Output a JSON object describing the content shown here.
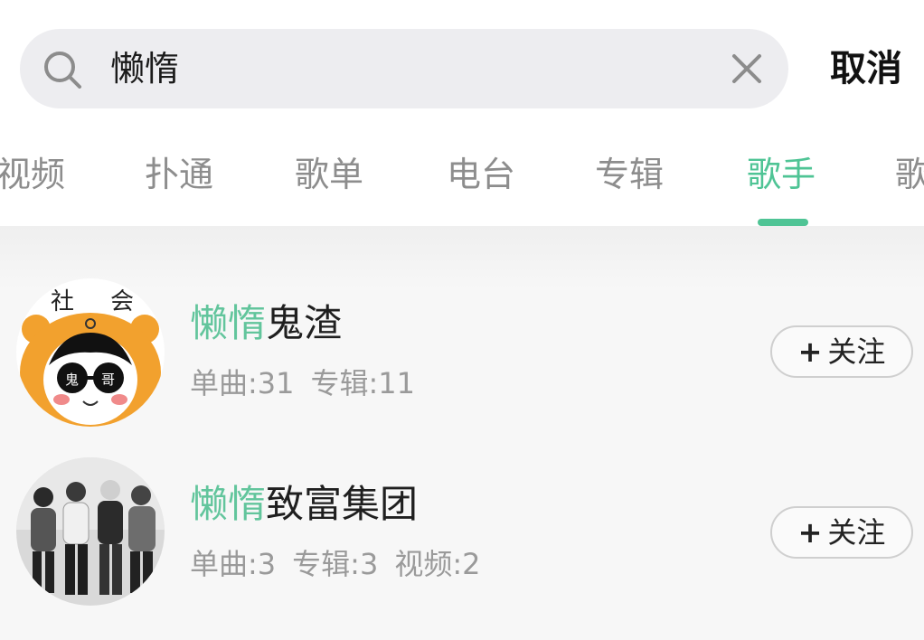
{
  "search": {
    "query": "懒惰",
    "cancel_label": "取消"
  },
  "tabs": [
    {
      "label": "视频",
      "active": false
    },
    {
      "label": "扑通",
      "active": false
    },
    {
      "label": "歌单",
      "active": false
    },
    {
      "label": "电台",
      "active": false
    },
    {
      "label": "专辑",
      "active": false
    },
    {
      "label": "歌手",
      "active": true
    },
    {
      "label": "歌",
      "active": false
    }
  ],
  "colors": {
    "accent": "#4fc495",
    "highlight": "#62c59c"
  },
  "results": [
    {
      "name_highlight": "懒惰",
      "name_rest": "鬼渣",
      "stats": [
        "单曲:31",
        "专辑:11"
      ],
      "follow_plus": "+",
      "follow_label": "关注",
      "avatar_text": [
        "社",
        "会",
        "鬼",
        "哥"
      ]
    },
    {
      "name_highlight": "懒惰",
      "name_rest": "致富集团",
      "stats": [
        "单曲:3",
        "专辑:3",
        "视频:2"
      ],
      "follow_plus": "+",
      "follow_label": "关注"
    }
  ]
}
